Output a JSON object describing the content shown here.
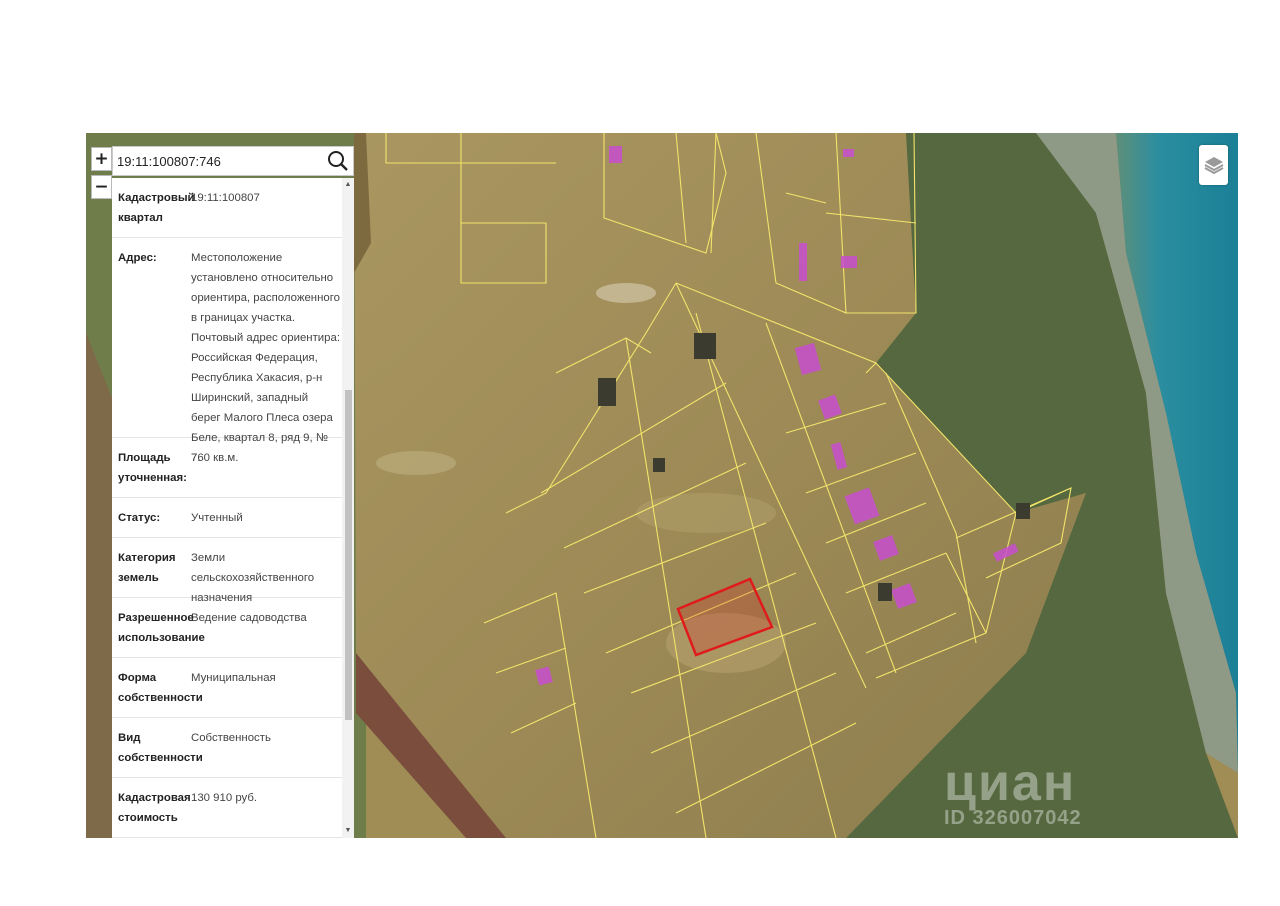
{
  "search": {
    "value": "19:11:100807:746"
  },
  "map_controls": {
    "zoom_in": "+",
    "zoom_out": "−"
  },
  "info": {
    "rows": [
      {
        "label": "Кадастровый квартал",
        "value": "19:11:100807"
      },
      {
        "label": "Адрес:",
        "value": "Местоположение установлено относительно ориентира, расположенного в границах участка. Почтовый адрес ориентира: Российская Федерация, Республика Хакасия, р-н Ширинский, западный берег Малого Плеса озера Беле, квартал 8, ряд 9, № 7."
      },
      {
        "label": "Площадь уточненная:",
        "value": "760 кв.м."
      },
      {
        "label": "Статус:",
        "value": "Учтенный"
      },
      {
        "label": "Категория земель",
        "value": "Земли сельскохозяйственного назначения"
      },
      {
        "label": "Разрешенное использование",
        "value": "Ведение садоводства"
      },
      {
        "label": "Форма собственности",
        "value": "Муниципальная"
      },
      {
        "label": "Вид собственности",
        "value": "Собственность"
      },
      {
        "label": "Кадастровая стоимость",
        "value": "130 910 руб."
      }
    ]
  },
  "watermark": {
    "logo": "циан",
    "id": "ID 326007042"
  },
  "icons": {
    "search": "search-icon",
    "layers": "layers-icon"
  },
  "colors": {
    "parcel_outline": "#f2e36b",
    "selected_parcel": "#e01b1b",
    "building": "#c84fd0",
    "water": "#1c8aa0"
  }
}
